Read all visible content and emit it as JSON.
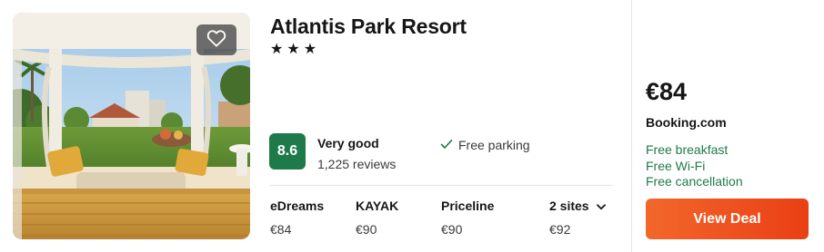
{
  "hotel": {
    "name": "Atlantis Park Resort",
    "stars": "★★★"
  },
  "photo": {
    "favorite_icon": "heart-icon"
  },
  "rating": {
    "score": "8.6",
    "label": "Very good",
    "reviews": "1,225 reviews"
  },
  "amenity": {
    "icon": "check-icon",
    "text": "Free parking"
  },
  "sites": [
    {
      "name": "eDreams",
      "price": "€84"
    },
    {
      "name": "KAYAK",
      "price": "€90"
    },
    {
      "name": "Priceline",
      "price": "€90"
    },
    {
      "name": "2 sites",
      "price": "€92",
      "icon": "chevron-down-icon"
    }
  ],
  "deal": {
    "price": "€84",
    "provider": "Booking.com",
    "perks": [
      "Free breakfast",
      "Free Wi-Fi",
      "Free cancellation"
    ],
    "button_label": "View Deal"
  },
  "colors": {
    "score_bg": "#1f7a4a",
    "perk_text": "#1f7a4a",
    "deal_button": "#ea4d1a"
  }
}
